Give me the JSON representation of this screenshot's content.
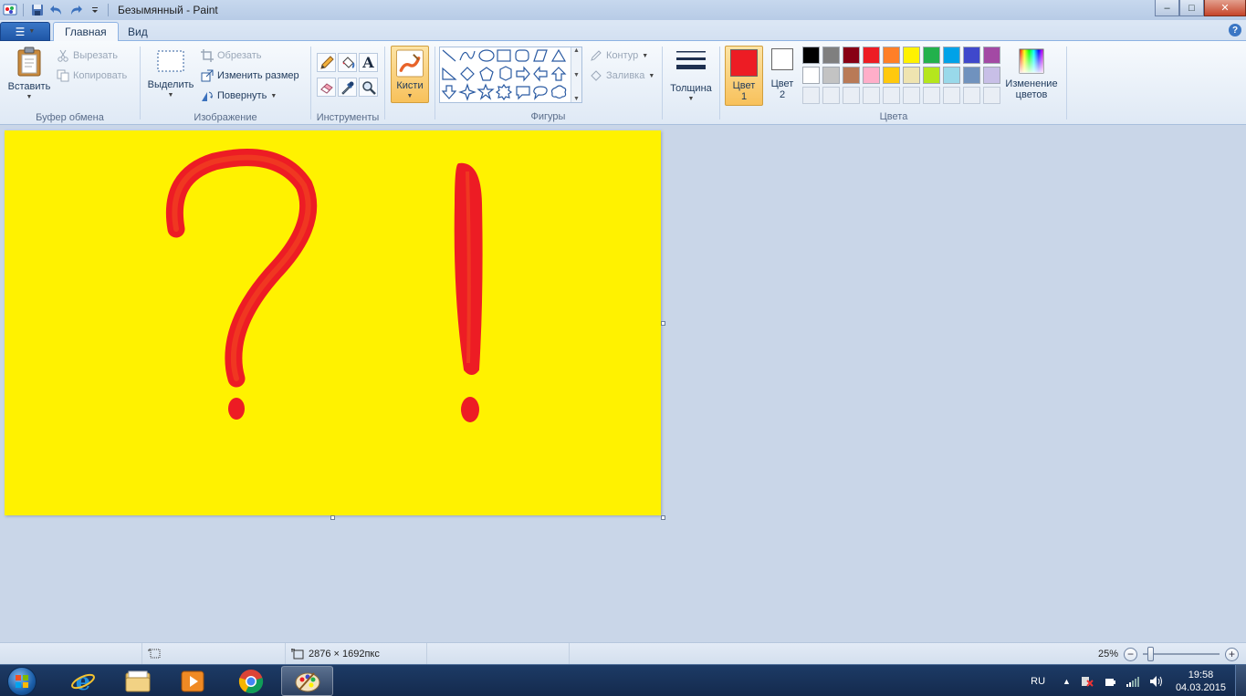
{
  "window": {
    "title": "Безымянный - Paint",
    "controls": {
      "minimize": "‒",
      "maximize": "□",
      "close": "✕"
    }
  },
  "ribbon_tabs": {
    "file_tab": "☰",
    "home": "Главная",
    "view": "Вид",
    "help": "?"
  },
  "clipboard": {
    "paste": "Вставить",
    "cut": "Вырезать",
    "copy": "Копировать",
    "group": "Буфер обмена"
  },
  "image": {
    "select": "Выделить",
    "crop": "Обрезать",
    "resize": "Изменить размер",
    "rotate": "Повернуть",
    "group": "Изображение"
  },
  "tools": {
    "group": "Инструменты",
    "text_tool": "A"
  },
  "brushes": {
    "label": "Кисти"
  },
  "shapes": {
    "outline": "Контур",
    "fill": "Заливка",
    "group": "Фигуры"
  },
  "size": {
    "label": "Толщина"
  },
  "colors": {
    "color1_label": "Цвет",
    "color1_num": "1",
    "color2_label": "Цвет",
    "color2_num": "2",
    "edit_colors_line1": "Изменение",
    "edit_colors_line2": "цветов",
    "group": "Цвета",
    "color1": "#ed1c24",
    "color2": "#ffffff",
    "palette_row1": [
      "#000000",
      "#7f7f7f",
      "#880015",
      "#ed1c24",
      "#ff7f27",
      "#fff200",
      "#22b14c",
      "#00a2e8",
      "#3f48cc",
      "#a349a4"
    ],
    "palette_row2": [
      "#ffffff",
      "#c3c3c3",
      "#b97a57",
      "#ffaec9",
      "#ffc90e",
      "#efe4b0",
      "#b5e61d",
      "#99d9ea",
      "#7092be",
      "#c8bfe7"
    ]
  },
  "canvas": {
    "background": "#fff200",
    "ink": "#ed1c24"
  },
  "status": {
    "dimensions": "2876 × 1692пкс",
    "zoom": "25%",
    "zoom_level": 0.1
  },
  "taskbar": {
    "lang": "RU",
    "time": "19:58",
    "date": "04.03.2015"
  }
}
